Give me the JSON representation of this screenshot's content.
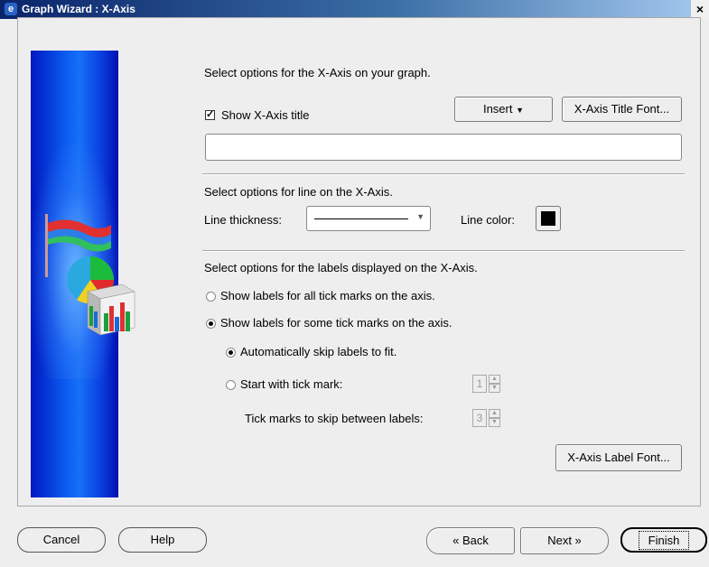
{
  "window": {
    "title": "Graph Wizard : X-Axis",
    "close_glyph": "×",
    "app_icon": "graph-wizard-icon"
  },
  "intro": "Select options for the X-Axis on your graph.",
  "title_section": {
    "show_title_checkbox": {
      "label": "Show X-Axis title",
      "checked": true
    },
    "insert_button": "Insert",
    "title_font_button": "X-Axis Title Font...",
    "title_input": {
      "value": ""
    }
  },
  "line_section": {
    "heading": "Select options for line on the X-Axis.",
    "thickness_label": "Line thickness:",
    "color_label": "Line color:",
    "color_value": "#000000"
  },
  "labels_section": {
    "heading": "Select options for the labels displayed on the X-Axis.",
    "radio_all": {
      "label": "Show labels for all tick marks on the axis.",
      "selected": false
    },
    "radio_some": {
      "label": "Show labels for some tick marks on the axis.",
      "selected": true
    },
    "radio_auto": {
      "label": "Automatically skip labels to fit.",
      "selected": true
    },
    "radio_start": {
      "label": "Start with tick mark:",
      "selected": false
    },
    "start_value": "1",
    "skip_label": "Tick marks to skip between labels:",
    "skip_value": "3",
    "label_font_button": "X-Axis Label Font..."
  },
  "footer": {
    "cancel": "Cancel",
    "help": "Help",
    "back": "Back",
    "next": "Next",
    "finish": "Finish"
  }
}
